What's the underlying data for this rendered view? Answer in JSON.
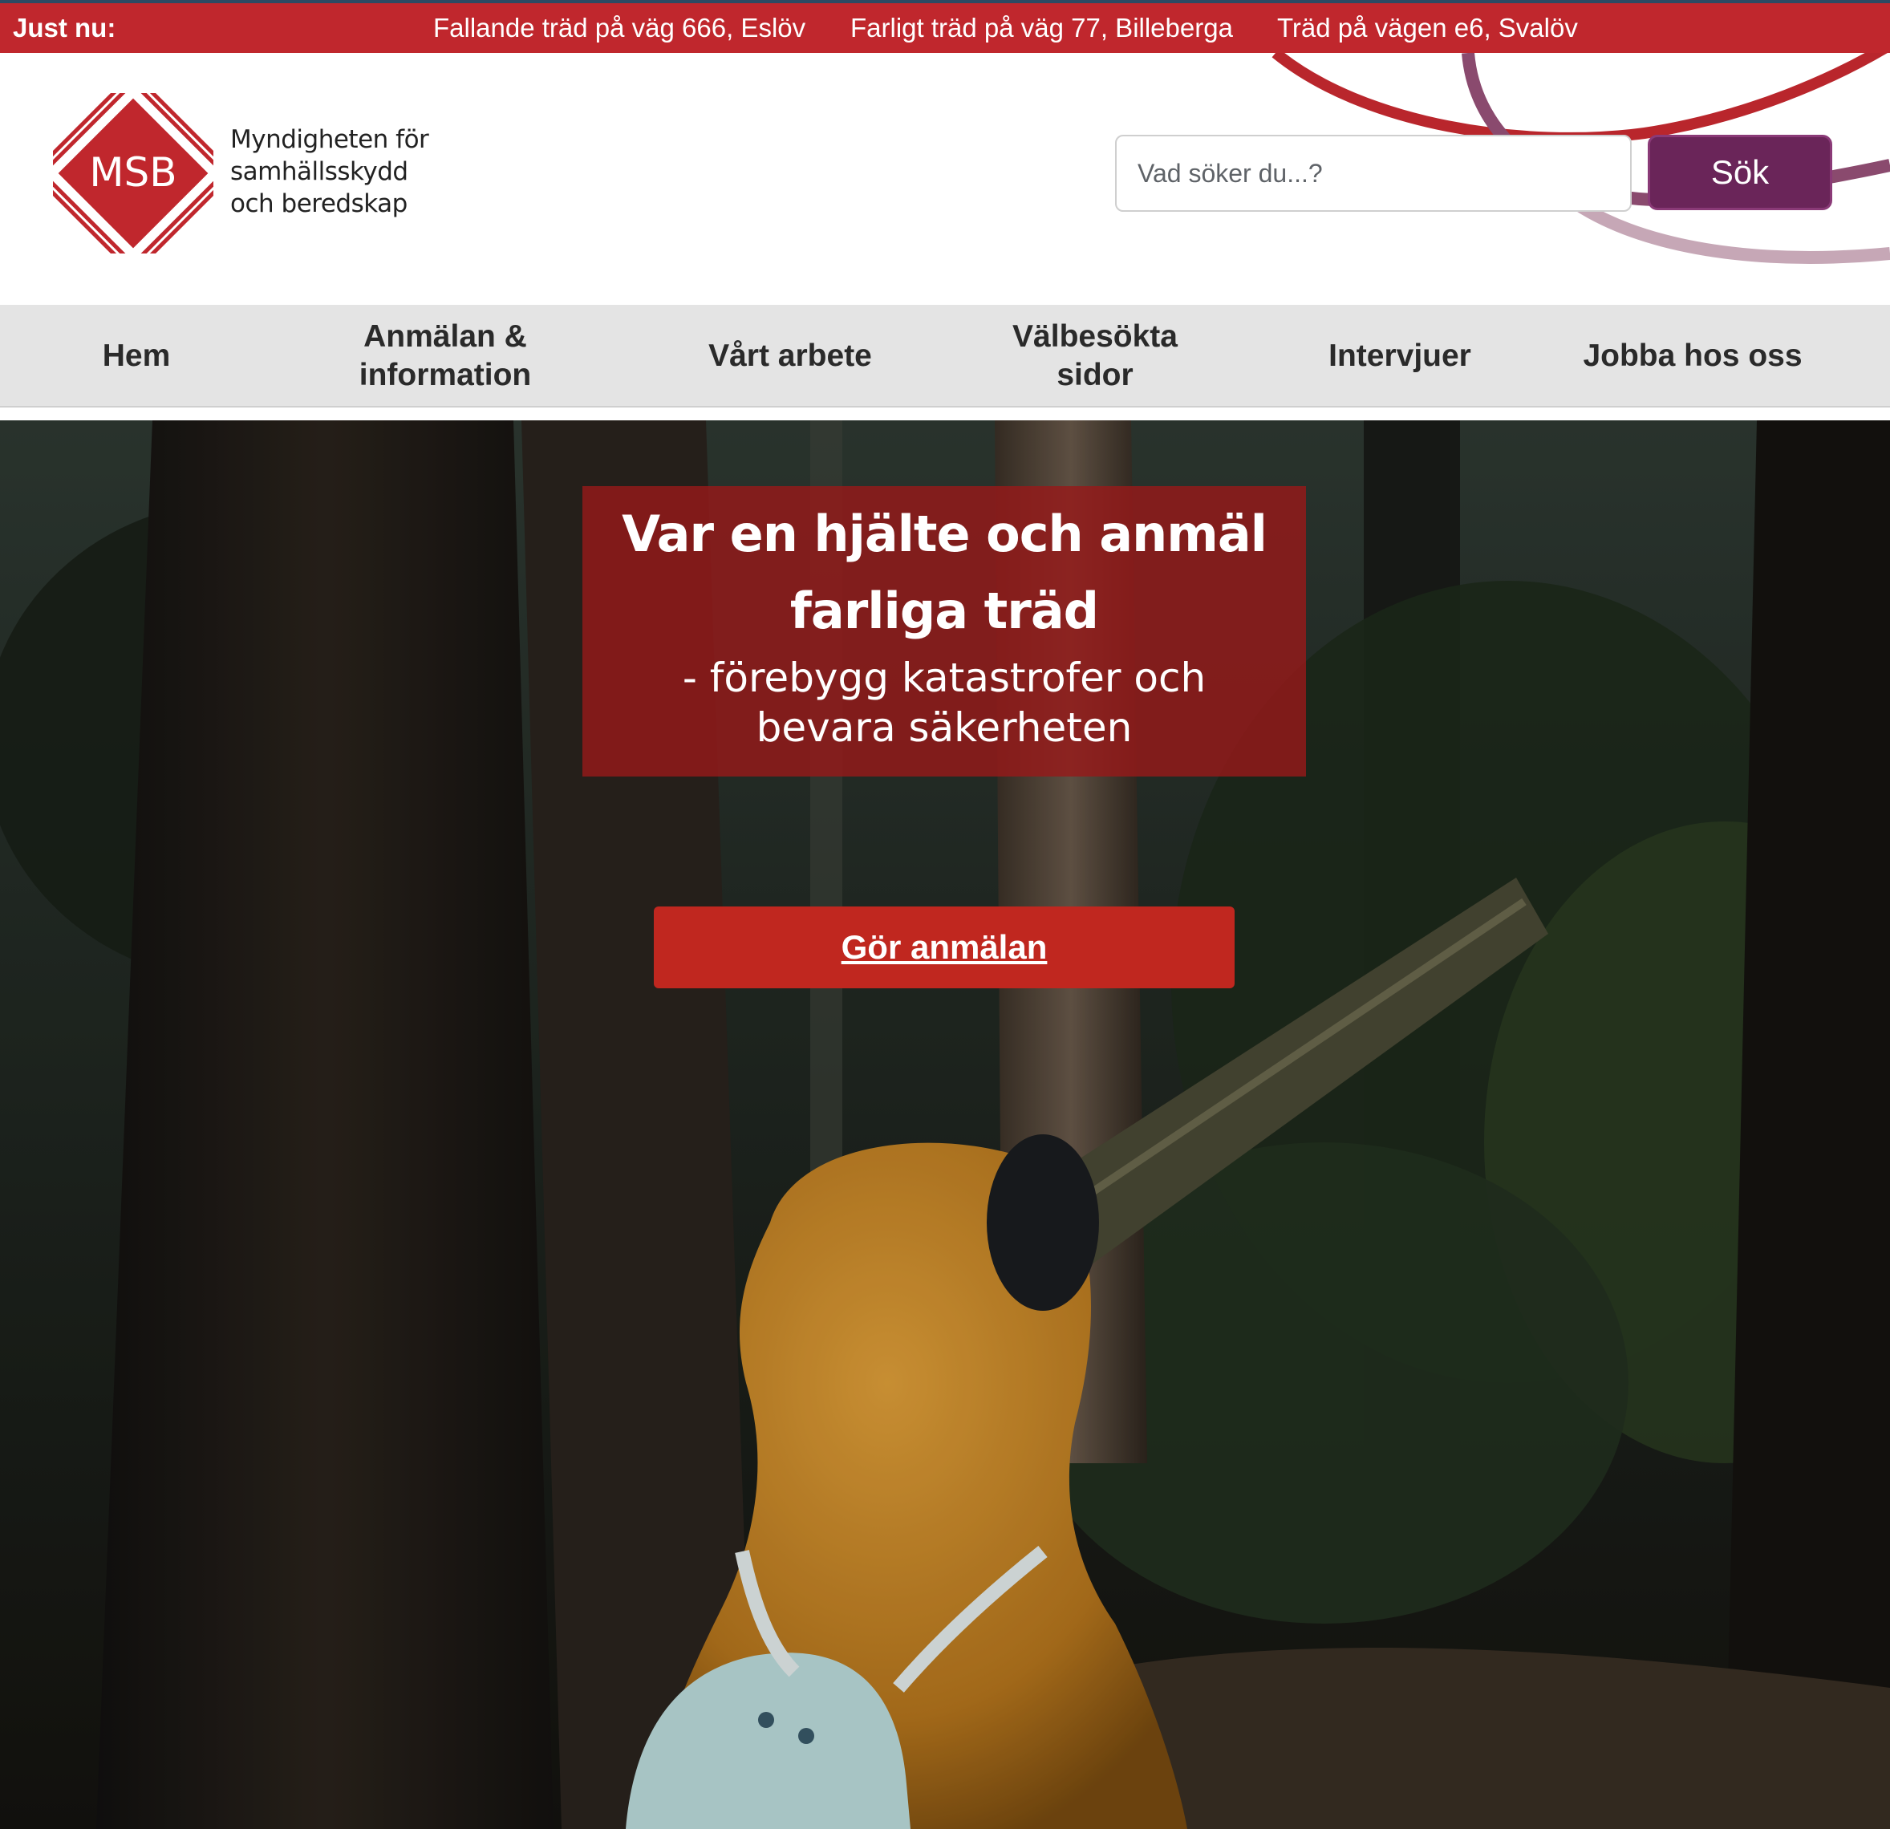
{
  "ticker": {
    "label": "Just nu:",
    "items": [
      "Fallande träd på väg 666, Eslöv",
      "Farligt träd på väg 77, Billeberga",
      "Träd på vägen e6, Svalöv"
    ]
  },
  "brand": {
    "logo_text": "MSB",
    "name_lines": [
      "Myndigheten för",
      "samhällsskydd",
      "och beredskap"
    ]
  },
  "search": {
    "placeholder": "Vad söker du...?",
    "value": "",
    "button_label": "Sök"
  },
  "nav": {
    "items": [
      {
        "label": "Hem"
      },
      {
        "label": "Anmälan & information"
      },
      {
        "label": "Vårt arbete"
      },
      {
        "label": "Välbesökta sidor"
      },
      {
        "label": "Intervjuer"
      },
      {
        "label": "Jobba hos oss"
      }
    ]
  },
  "hero": {
    "headline": "Var en hjälte och anmäl farliga träd",
    "subheadline": "- förebygg katastrofer och bevara säkerheten",
    "cta_label": "Gör anmälan"
  },
  "colors": {
    "brand_red": "#c0272d",
    "search_button": "#6a2559",
    "nav_background": "#e4e4e4"
  }
}
